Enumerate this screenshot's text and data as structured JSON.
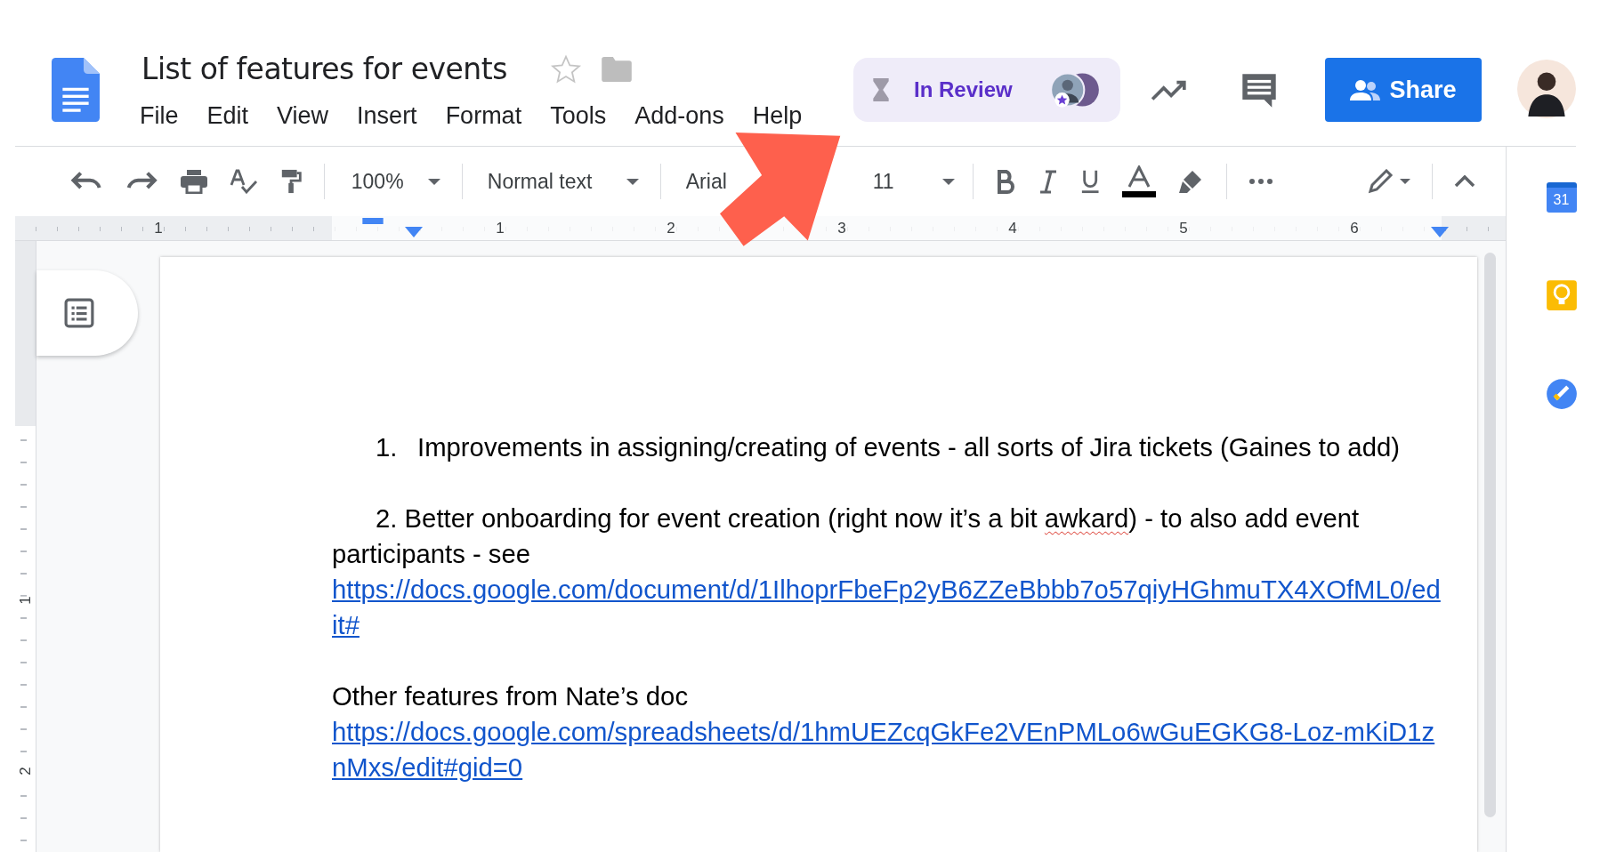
{
  "document": {
    "title": "List of features for events",
    "starred": false
  },
  "menu": [
    "File",
    "Edit",
    "View",
    "Insert",
    "Format",
    "Tools",
    "Add-ons",
    "Help"
  ],
  "review_chip": {
    "status": "In Review"
  },
  "share_button": {
    "label": "Share"
  },
  "toolbar": {
    "zoom": "100%",
    "style": "Normal text",
    "font": "Arial",
    "size": "11"
  },
  "ruler": {
    "labels": [
      "1",
      "1",
      "2",
      "3",
      "4",
      "5",
      "6"
    ],
    "vertical_labels": [
      "1",
      "2"
    ]
  },
  "side_panel": {
    "calendar_day": "31"
  },
  "paragraphs": [
    {
      "kind": "numbered",
      "number": "1.",
      "runs": [
        {
          "text": "Improvements in assigning/creating of events - all sorts of Jira tickets (Gaines to add)",
          "misspelled": false
        }
      ]
    },
    {
      "kind": "indented",
      "runs": [
        {
          "text": "2. Better onboarding for event creation (right now it’s a bit ",
          "misspelled": false
        },
        {
          "text": "awkard",
          "misspelled": true
        },
        {
          "text": ") - to also add event participants - see",
          "misspelled": false
        }
      ]
    },
    {
      "kind": "link",
      "text": "https://docs.google.com/document/d/1IlhoprFbeFp2yB6ZZeBbbb7o57qiyHGhmuTX4XOfML0/edit#"
    },
    {
      "kind": "spacer"
    },
    {
      "kind": "plain",
      "runs": [
        {
          "text": "Other features from Nate’s doc",
          "misspelled": false
        }
      ]
    },
    {
      "kind": "link",
      "text": "https://docs.google.com/spreadsheets/d/1hmUEZcqGkFe2VEnPMLo6wGuEGKG8-Loz-mKiD1znMxs/edit#gid=0"
    }
  ]
}
